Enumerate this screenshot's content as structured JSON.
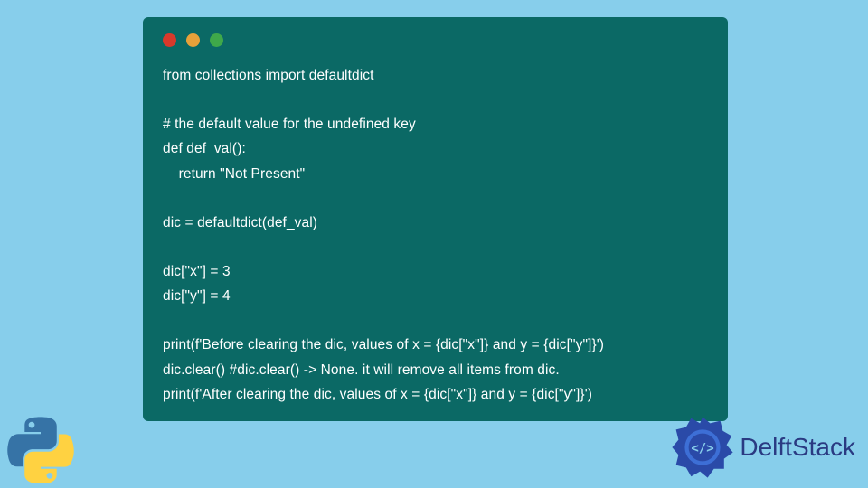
{
  "code": {
    "line1": "from collections import defaultdict",
    "line2": "",
    "line3": "# the default value for the undefined key",
    "line4": "def def_val():",
    "line5": "    return \"Not Present\"",
    "line6": "",
    "line7": "dic = defaultdict(def_val)",
    "line8": "",
    "line9": "dic[\"x\"] = 3",
    "line10": "dic[\"y\"] = 4",
    "line11": "",
    "line12": "print(f'Before clearing the dic, values of x = {dic[\"x\"]} and y = {dic[\"y\"]}')",
    "line13": "dic.clear() #dic.clear() -> None. it will remove all items from dic.",
    "line14": "print(f'After clearing the dic, values of x = {dic[\"x\"]} and y = {dic[\"y\"]}')"
  },
  "brand": {
    "name": "DelftStack"
  },
  "colors": {
    "background": "#87ceeb",
    "window": "#0b6965",
    "text": "#ffffff",
    "brand": "#2a3a82"
  }
}
